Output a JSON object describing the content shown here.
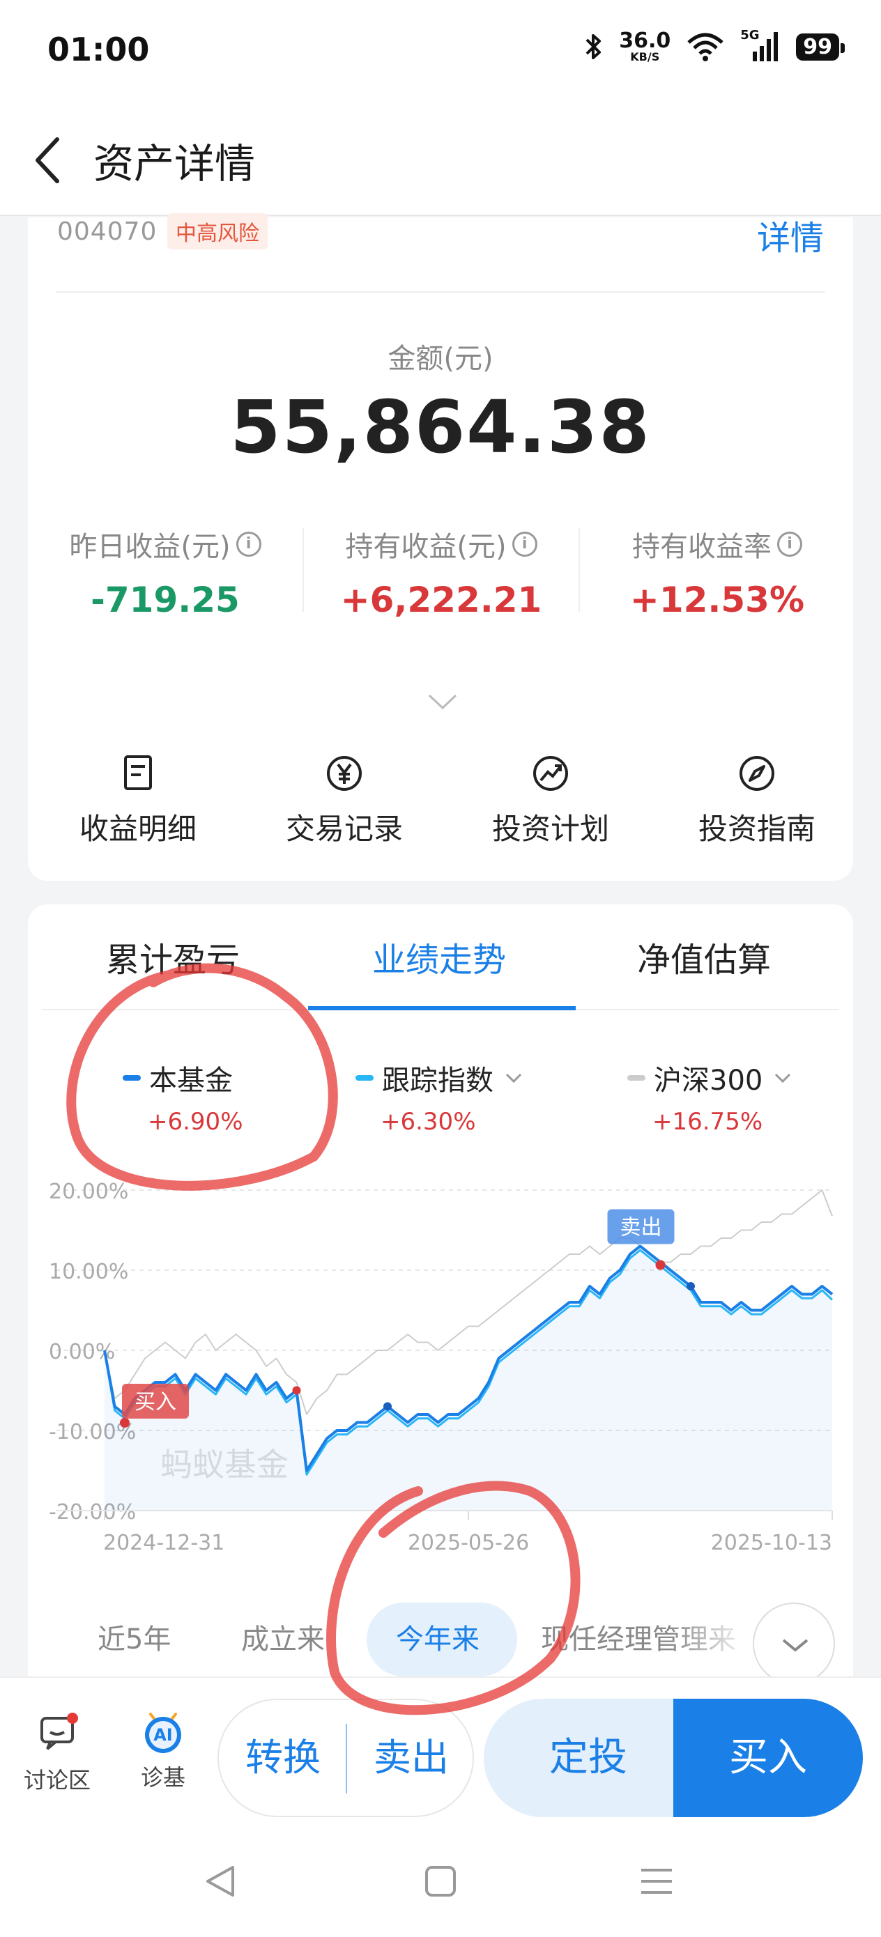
{
  "status": {
    "time": "01:00",
    "net_speed": "36.0",
    "net_unit": "KB/S",
    "signal": "5G",
    "battery": "99"
  },
  "nav": {
    "title": "资产详情"
  },
  "fund": {
    "code": "004070",
    "risk": "中高风险",
    "detail_link": "详情"
  },
  "amount": {
    "label": "金额(元)",
    "value": "55,864.38"
  },
  "stats": [
    {
      "label": "昨日收益(元)",
      "value": "-719.25",
      "color": "#1a9966"
    },
    {
      "label": "持有收益(元)",
      "value": "+6,222.21",
      "color": "#d9383a"
    },
    {
      "label": "持有收益率",
      "value": "+12.53%",
      "color": "#d9383a"
    }
  ],
  "menu": [
    {
      "label": "收益明细",
      "icon": "document-icon"
    },
    {
      "label": "交易记录",
      "icon": "yen-icon"
    },
    {
      "label": "投资计划",
      "icon": "trend-icon"
    },
    {
      "label": "投资指南",
      "icon": "compass-icon"
    }
  ],
  "tabs": [
    "累计盈亏",
    "业绩走势",
    "净值估算"
  ],
  "active_tab": "业绩走势",
  "legend": [
    {
      "name": "本基金",
      "value": "+6.90%",
      "color": "#1a7fe6"
    },
    {
      "name": "跟踪指数",
      "value": "+6.30%",
      "color": "#29b6f6"
    },
    {
      "name": "沪深300",
      "value": "+16.75%",
      "color": "#cccccc"
    }
  ],
  "chart_data": {
    "type": "line",
    "y_ticks": [
      "20.00%",
      "10.00%",
      "0.00%",
      "-10.00%",
      "-20.00%"
    ],
    "x_ticks": [
      "2024-12-31",
      "2025-05-26",
      "2025-10-13"
    ],
    "ylim": [
      -20,
      20
    ],
    "watermark": "蚂蚁基金",
    "markers": {
      "buy": "买入",
      "sell": "卖出"
    },
    "series": [
      {
        "name": "本基金",
        "color": "#1a7fe6",
        "values": [
          0,
          -7,
          -8,
          -6,
          -5,
          -4,
          -4,
          -3,
          -5,
          -3,
          -4,
          -5,
          -3,
          -4,
          -5,
          -3,
          -5,
          -4,
          -6,
          -5,
          -15,
          -13,
          -11,
          -10,
          -10,
          -9,
          -9,
          -8,
          -7,
          -8,
          -9,
          -8,
          -8,
          -9,
          -8,
          -8,
          -7,
          -6,
          -4,
          -1,
          0,
          1,
          2,
          3,
          4,
          5,
          6,
          6,
          8,
          7,
          9,
          10,
          12,
          13,
          12,
          11,
          10,
          9,
          8,
          6,
          6,
          6,
          5,
          6,
          5,
          5,
          6,
          7,
          8,
          7,
          7,
          8,
          7
        ]
      },
      {
        "name": "跟踪指数",
        "color": "#29b6f6",
        "values": [
          0,
          -7.5,
          -8.5,
          -6.5,
          -5.5,
          -4.5,
          -4.5,
          -3.5,
          -5.5,
          -3.5,
          -4.5,
          -5.5,
          -3.5,
          -4.5,
          -5.5,
          -3.5,
          -5.5,
          -4.5,
          -6.5,
          -5.5,
          -15.5,
          -13.5,
          -11.5,
          -10.5,
          -10.5,
          -9.5,
          -9.5,
          -8.5,
          -7.5,
          -8.5,
          -9.5,
          -8.5,
          -8.5,
          -9.5,
          -8.5,
          -8.5,
          -7.5,
          -6.5,
          -4.5,
          -1.5,
          -0.5,
          0.5,
          1.5,
          2.5,
          3.5,
          4.5,
          5.5,
          5.5,
          7.5,
          6.5,
          8.5,
          9.5,
          11.5,
          12.5,
          11.5,
          10.5,
          9.5,
          8.5,
          7.5,
          5.5,
          5.5,
          5.5,
          4.5,
          5.5,
          4.5,
          4.5,
          5.5,
          6.5,
          7.5,
          6.5,
          6.5,
          7.5,
          6.3
        ]
      },
      {
        "name": "沪深300",
        "color": "#cccccc",
        "values": [
          0,
          -6,
          -5,
          -3,
          -1,
          0,
          1,
          0,
          -1,
          1,
          2,
          0,
          1,
          2,
          1,
          0,
          -2,
          -1,
          -3,
          -4,
          -8,
          -6,
          -5,
          -3,
          -3,
          -2,
          -1,
          0,
          0,
          1,
          2,
          1,
          1,
          0,
          1,
          2,
          3,
          3,
          4,
          5,
          6,
          7,
          8,
          9,
          10,
          11,
          12,
          12,
          13,
          12,
          13,
          14,
          14,
          13,
          12,
          11,
          11,
          12,
          12,
          13,
          13,
          14,
          14,
          15,
          15,
          16,
          16,
          17,
          17,
          18,
          19,
          20,
          16.75
        ]
      }
    ]
  },
  "ranges": [
    "近5年",
    "成立来",
    "今年来",
    "现任经理管理来"
  ],
  "active_range": "今年来",
  "bottom": {
    "forum": "讨论区",
    "diagnose": "诊基",
    "ai_badge": "AI",
    "convert": "转换",
    "sell": "卖出",
    "fixed": "定投",
    "buy": "买入"
  }
}
